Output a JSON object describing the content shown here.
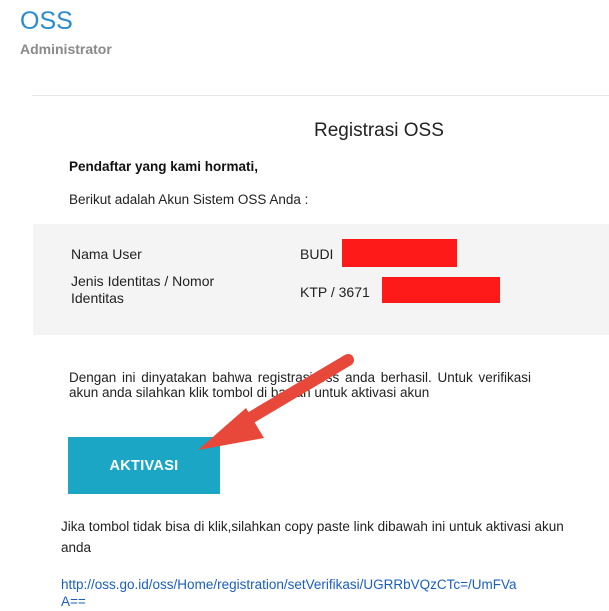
{
  "sender": {
    "name": "OSS",
    "role": "Administrator"
  },
  "email": {
    "title": "Registrasi OSS",
    "salutation": "Pendaftar yang kami hormati,",
    "intro": "Berikut adalah Akun Sistem OSS Anda :",
    "account": {
      "user_label": "Nama User",
      "user_value": "BUDI",
      "id_label": "Jenis Identitas / Nomor Identitas",
      "id_value": "KTP / 3671"
    },
    "body": "Dengan ini dinyatakan bahwa registrasi oss anda berhasil. Untuk verifikasi akun anda silahkan klik tombol di bawah untuk aktivasi akun",
    "activate_button": "AKTIVASI",
    "fallback": "Jika tombol tidak bisa di klik,silahkan copy paste link dibawah ini untuk aktivasi akun anda",
    "link": "http://oss.go.id/oss/Home/registration/setVerifikasi/UGRRbVQzCTc=/UmFVaA=="
  },
  "colors": {
    "brand": "#2a8bd0",
    "button": "#1aa6c4",
    "redaction": "#ff1a1a",
    "arrow": "#e8483a",
    "link": "#1a5fc0"
  },
  "annotation": {
    "arrow_icon": "pointer-arrow-icon"
  }
}
